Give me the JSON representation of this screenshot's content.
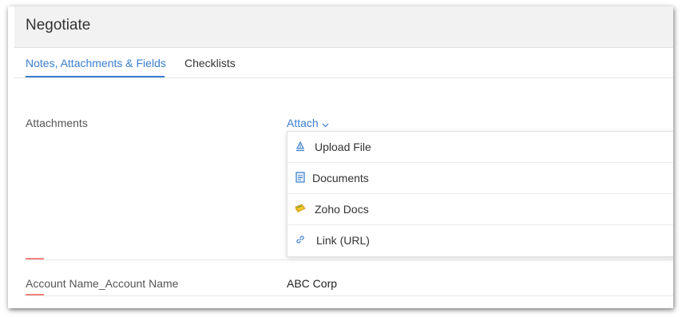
{
  "header": {
    "title": "Negotiate"
  },
  "tabs": [
    {
      "label": "Notes, Attachments & Fields",
      "active": true
    },
    {
      "label": "Checklists",
      "active": false
    }
  ],
  "attachments": {
    "label": "Attachments",
    "attach_label": "Attach",
    "menu": [
      {
        "label": "Upload File",
        "icon": "upload-icon"
      },
      {
        "label": "Documents",
        "icon": "document-icon"
      },
      {
        "label": "Zoho Docs",
        "icon": "zoho-docs-icon"
      },
      {
        "label": "Link (URL)",
        "icon": "link-icon"
      }
    ]
  },
  "fields": [
    {
      "label": "Account Name_Account Name",
      "value": "ABC Corp"
    }
  ],
  "colors": {
    "accent": "#3a7fcf",
    "header_bg": "#f2f2f2",
    "required_marker": "#f0857c"
  }
}
